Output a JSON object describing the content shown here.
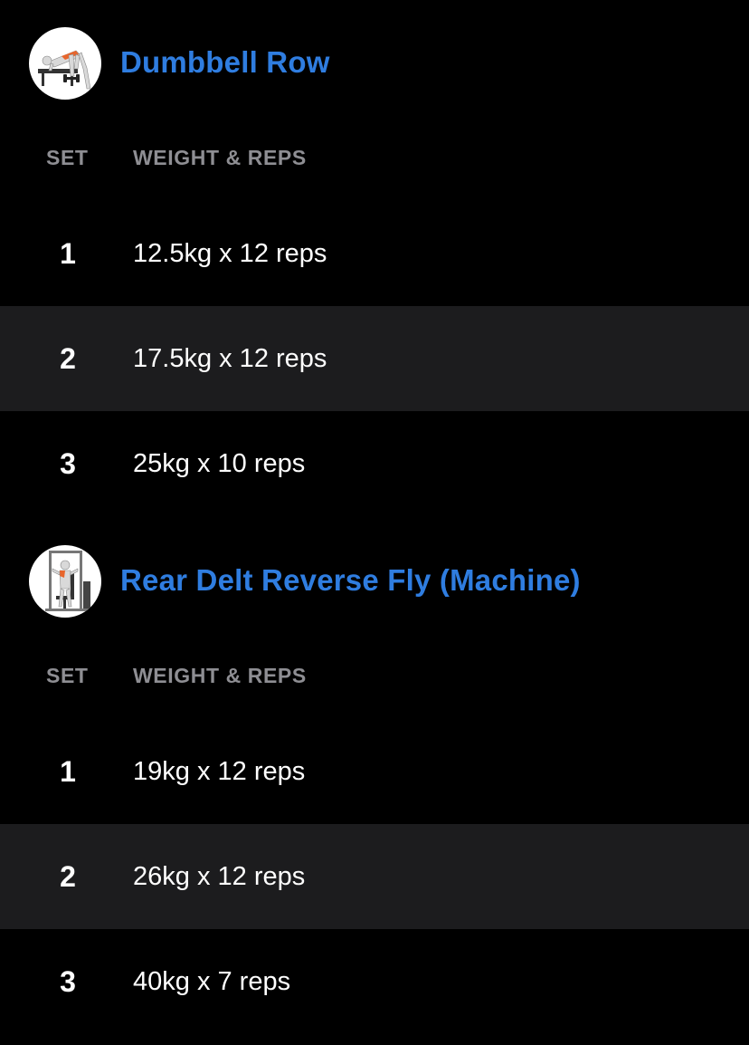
{
  "theme": {
    "accent": "#2f7de0",
    "background": "#000000",
    "row_alt": "#1c1c1e",
    "header_gray": "#8e8e93"
  },
  "exercises": [
    {
      "title": "Dumbbell Row",
      "thumb_icon": "dumbbell-row-icon",
      "col_set": "SET",
      "col_weight_reps": "WEIGHT & REPS",
      "sets": [
        {
          "num": "1",
          "value": "12.5kg x 12 reps"
        },
        {
          "num": "2",
          "value": "17.5kg x 12 reps"
        },
        {
          "num": "3",
          "value": "25kg x 10 reps"
        }
      ]
    },
    {
      "title": "Rear Delt Reverse Fly (Machine)",
      "thumb_icon": "rear-delt-machine-icon",
      "col_set": "SET",
      "col_weight_reps": "WEIGHT & REPS",
      "sets": [
        {
          "num": "1",
          "value": "19kg x 12 reps"
        },
        {
          "num": "2",
          "value": "26kg x 12 reps"
        },
        {
          "num": "3",
          "value": "40kg x 7 reps"
        }
      ]
    }
  ]
}
